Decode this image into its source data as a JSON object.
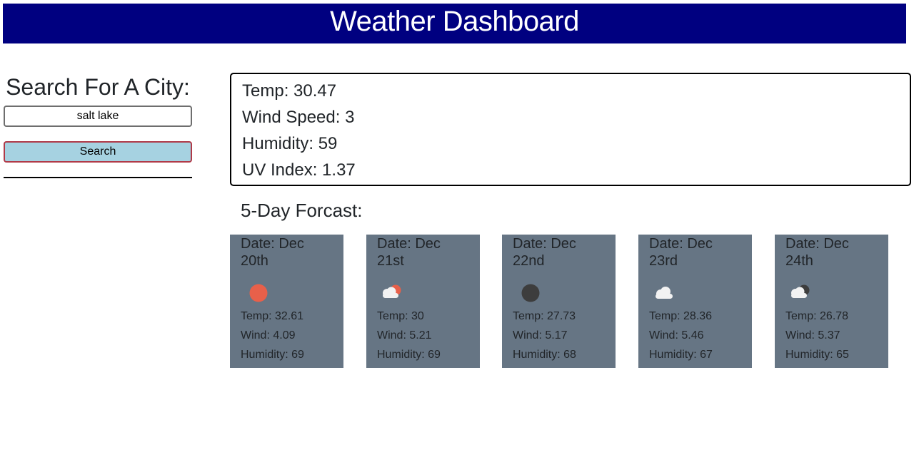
{
  "header": {
    "title": "Weather Dashboard"
  },
  "sidebar": {
    "heading": "Search For A City:",
    "search_value": "salt lake",
    "search_button_label": "Search"
  },
  "current": {
    "temp": "Temp: 30.47",
    "wind": "Wind Speed: 3",
    "humidity": "Humidity: 59",
    "uv": "UV Index: 1.37"
  },
  "forecast": {
    "heading": "5-Day Forcast:",
    "days": [
      {
        "date": "Date: Dec 20th",
        "icon": "sun-icon",
        "temp": "Temp: 32.61",
        "wind": "Wind: 4.09",
        "humidity": "Humidity: 69"
      },
      {
        "date": "Date: Dec 21st",
        "icon": "partly-cloudy-day-icon",
        "temp": "Temp: 30",
        "wind": "Wind: 5.21",
        "humidity": "Humidity: 69"
      },
      {
        "date": "Date: Dec 22nd",
        "icon": "moon-icon",
        "temp": "Temp: 27.73",
        "wind": "Wind: 5.17",
        "humidity": "Humidity: 68"
      },
      {
        "date": "Date: Dec 23rd",
        "icon": "cloud-icon",
        "temp": "Temp: 28.36",
        "wind": "Wind: 5.46",
        "humidity": "Humidity: 67"
      },
      {
        "date": "Date: Dec 24th",
        "icon": "partly-cloudy-night-icon",
        "temp": "Temp: 26.78",
        "wind": "Wind: 5.37",
        "humidity": "Humidity: 65"
      }
    ]
  },
  "colors": {
    "header_bg": "#000080",
    "card_bg": "#667584",
    "button_bg": "#a6d2e1",
    "button_border": "#b03a48",
    "sun": "#e8604a",
    "moon": "#3d3d3d",
    "cloud": "#f2f2f2"
  }
}
